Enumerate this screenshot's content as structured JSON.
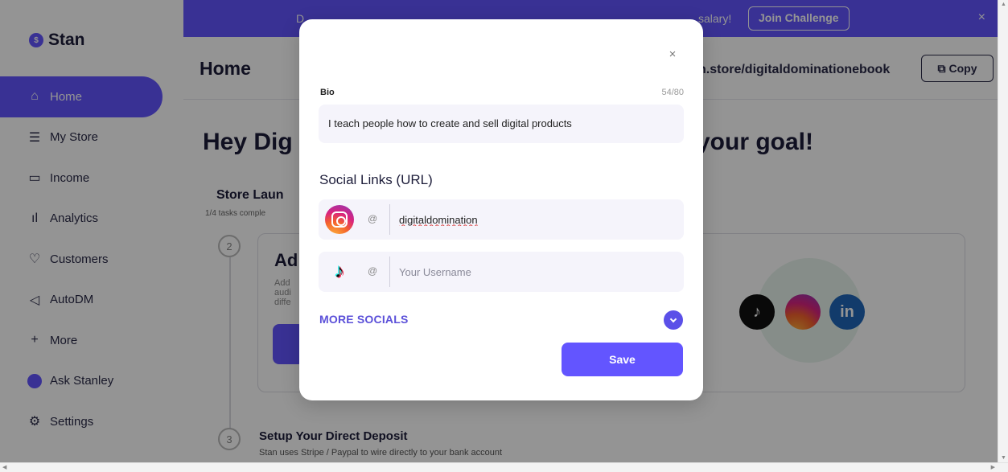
{
  "app": {
    "logo_text": "Stan",
    "logo_badge": "$"
  },
  "sidebar": {
    "items": [
      {
        "label": "Home",
        "icon": "⌂"
      },
      {
        "label": "My Store",
        "icon": "☰"
      },
      {
        "label": "Income",
        "icon": "▭"
      },
      {
        "label": "Analytics",
        "icon": "ıl"
      },
      {
        "label": "Customers",
        "icon": "♡"
      },
      {
        "label": "AutoDM",
        "icon": "◁"
      },
      {
        "label": "More",
        "icon": "+"
      },
      {
        "label": "Ask Stanley",
        "icon": ""
      },
      {
        "label": "Settings",
        "icon": "⚙"
      }
    ]
  },
  "topbar": {
    "promo_left": "D",
    "promo_right": "salary!",
    "join_label": "Join Challenge",
    "close_glyph": "×"
  },
  "header": {
    "title": "Home",
    "store_url": "n.store/digitaldominationebook",
    "copy_label": "Copy",
    "copy_icon": "⧉"
  },
  "main": {
    "greeting_left": "Hey Dig",
    "greeting_right": "your goal!",
    "launch_title": "Store Laun",
    "launch_sub": "1/4 tasks comple",
    "step2": "2",
    "task_title": "Ad",
    "task_desc": "Add audi diffe",
    "step3": "3",
    "deposit_title": "Setup Your Direct Deposit",
    "deposit_sub": "Stan uses Stripe / Paypal to wire directly to your bank account",
    "social_glyphs": {
      "tiktok": "♪",
      "linkedin": "in"
    }
  },
  "modal": {
    "close_glyph": "×",
    "bio_label": "Bio",
    "bio_count": "54/80",
    "bio_text": "I teach people how to create and sell digital products",
    "social_title": "Social Links (URL)",
    "links": [
      {
        "network": "instagram",
        "at": "@",
        "value": "digitaldomination",
        "placeholder": "Your Username"
      },
      {
        "network": "tiktok",
        "at": "@",
        "value": "",
        "placeholder": "Your Username"
      }
    ],
    "more_socials": "MORE SOCIALS",
    "save_label": "Save"
  },
  "colors": {
    "brand": "#6355ff",
    "overlay": "rgba(0,0,0,0.42)"
  }
}
